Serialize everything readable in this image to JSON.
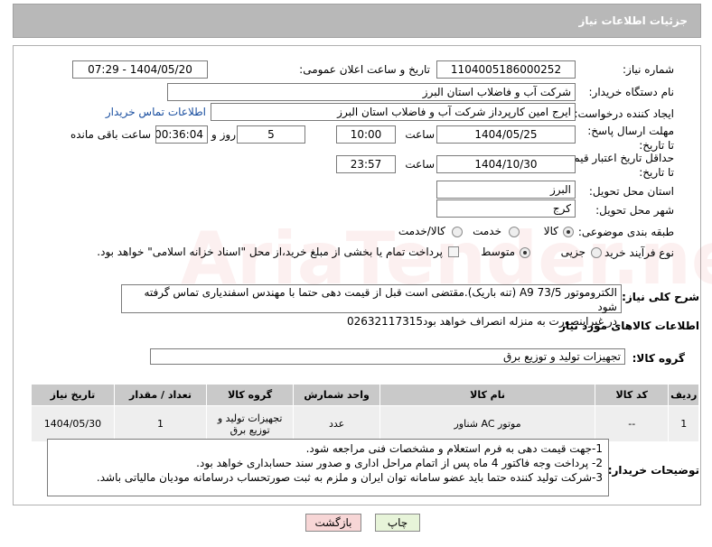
{
  "header": {
    "title": "جزئیات اطلاعات نیاز"
  },
  "labels": {
    "need_number": "شماره نیاز:",
    "announce_datetime": "تاریخ و ساعت اعلان عمومی:",
    "buyer_org": "نام دستگاه خریدار:",
    "requester": "ایجاد کننده درخواست:",
    "contact_link": "اطلاعات تماس خریدار",
    "reply_deadline": "مهلت ارسال پاسخ: تا تاریخ:",
    "time": "ساعت",
    "days_and": "روز و",
    "remaining": "ساعت باقی مانده",
    "price_validity": "حداقل تاریخ اعتبار قیمت: تا تاریخ:",
    "delivery_province": "استان محل تحویل:",
    "delivery_city": "شهر محل تحویل:",
    "subject_class": "طبقه بندی موضوعی:",
    "purchase_type": "نوع فرآیند خرید :",
    "need_desc": "شرح کلی نیاز:",
    "goods_info": "اطلاعات کالاهای مورد نیاز",
    "goods_group": "گروه کالا:",
    "buyer_notes": "توضیحات خریدار:"
  },
  "values": {
    "need_number": "1104005186000252",
    "announce_datetime": "1404/05/20 - 07:29",
    "buyer_org": "شرکت آب و فاضلاب استان البرز",
    "requester": "ایرج امین کارپرداز شرکت آب و فاضلاب استان البرز",
    "reply_date": "1404/05/25",
    "reply_time": "10:00",
    "days": "5",
    "remaining_time": "00:36:04",
    "validity_date": "1404/10/30",
    "validity_time": "23:57",
    "province": "البرز",
    "city": "کرج",
    "goods_group": "تجهیزات تولید و توزیع برق"
  },
  "subject_options": {
    "goods": "کالا",
    "service": "خدمت",
    "goods_service": "کالا/خدمت",
    "selected": "کالا"
  },
  "purchase_options": {
    "partial": "جزیی",
    "medium": "متوسط",
    "selected": "متوسط",
    "payment_note": "پرداخت تمام یا بخشی از مبلغ خرید،از محل \"اسناد خزانه اسلامی\" خواهد بود."
  },
  "need_desc": {
    "line1": "الکتروموتور A9 73/5 (تنه باریک).مقتضی است قبل از قیمت دهی حتما با مهندس اسفندیاری تماس گرفته شود",
    "line2": "در غیراینصورت به منزله انصراف خواهد بود02632117315"
  },
  "table": {
    "headers": [
      "ردیف",
      "کد کالا",
      "نام کالا",
      "واحد شمارش",
      "گروه کالا",
      "تعداد / مقدار",
      "تاریخ نیاز"
    ],
    "rows": [
      [
        "1",
        "--",
        "موتور AC شناور",
        "عدد",
        "تجهیزات تولید و توزیع برق",
        "1",
        "1404/05/30"
      ]
    ]
  },
  "buyer_notes": {
    "line1": "1-جهت قیمت دهی به فرم استعلام و مشخصات فنی مراجعه شود.",
    "line2": "2- پرداخت وجه فاکتور 4 ماه پس از اتمام مراحل اداری و صدور سند حسابداری خواهد بود.",
    "line3": "3-شرکت تولید کننده حتما باید عضو سامانه توان ایران و ملزم به ثبت صورتحساب درسامانه مودیان مالیاتی باشد."
  },
  "buttons": {
    "print": "چاپ",
    "back": "بازگشت"
  },
  "colors": {
    "header_bg": "#b8b8b8",
    "link": "#1a4fa0",
    "back_btn_bg": "#f7d6d6",
    "print_btn_bg": "#e7f4d9"
  }
}
